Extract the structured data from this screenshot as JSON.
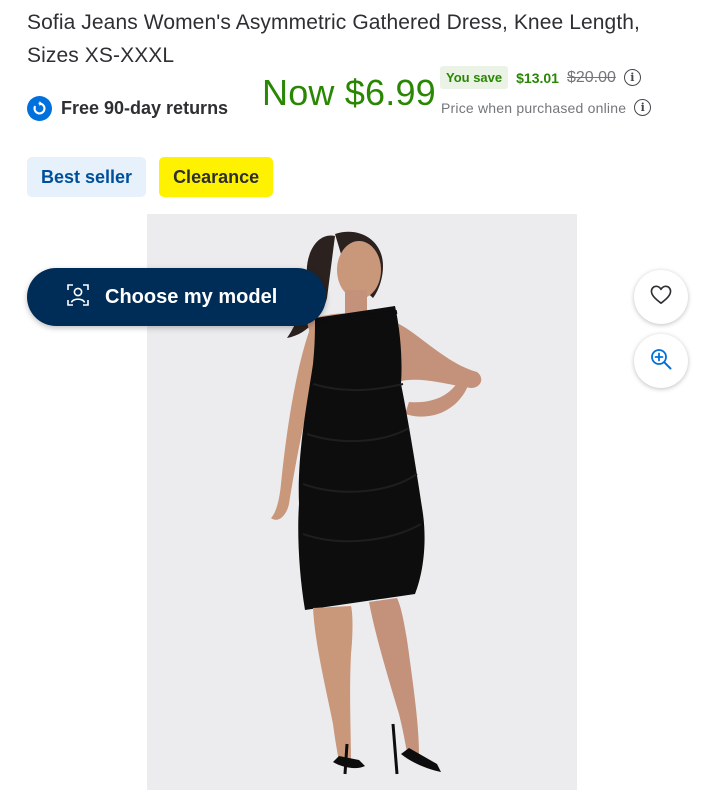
{
  "product": {
    "title": "Sofia Jeans Women's Asymmetric Gathered Dress, Knee Length, Sizes XS-XXXL"
  },
  "returns": {
    "label": "Free 90-day returns",
    "icon": "returns-icon"
  },
  "price": {
    "now": "Now $6.99",
    "you_save_label": "You save",
    "save_amount": "$13.01",
    "was": "$20.00",
    "note": "Price when purchased online"
  },
  "badges": {
    "best_seller": "Best seller",
    "clearance": "Clearance"
  },
  "image_actions": {
    "choose_model_label": "Choose my model",
    "favorite_icon": "heart-icon",
    "zoom_icon": "zoom-in-icon"
  },
  "colors": {
    "price_green": "#2a8703",
    "walmart_blue": "#0071dc",
    "navy": "#002d58",
    "clearance_yellow": "#fff200",
    "best_seller_bg": "#e6f1fc"
  }
}
